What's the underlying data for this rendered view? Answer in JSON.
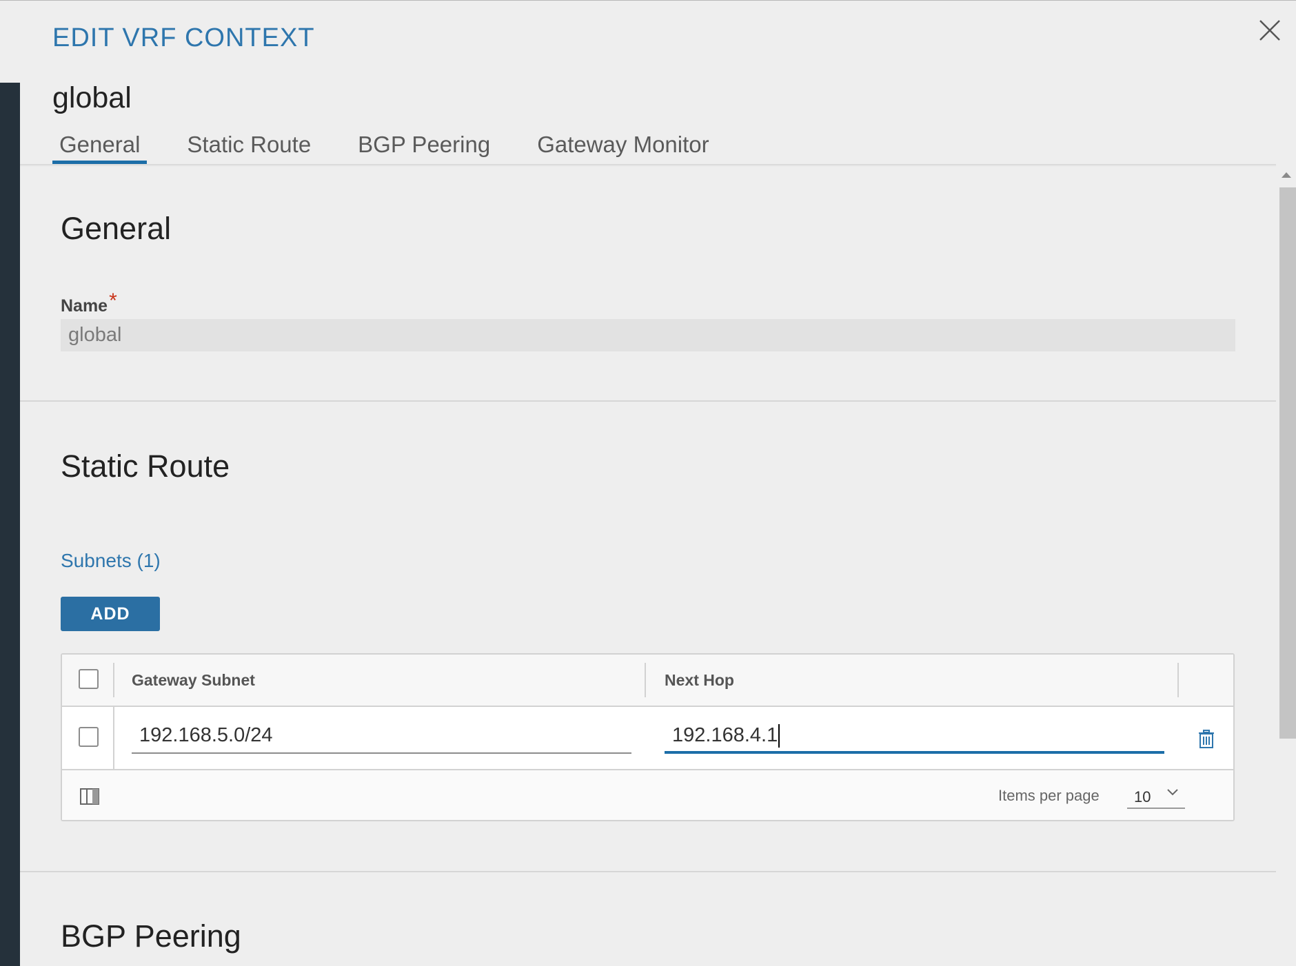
{
  "dialog": {
    "title": "EDIT VRF CONTEXT",
    "close_icon": "close-icon"
  },
  "header": {
    "name": "global"
  },
  "tabs": [
    {
      "label": "General",
      "active": true
    },
    {
      "label": "Static Route",
      "active": false
    },
    {
      "label": "BGP Peering",
      "active": false
    },
    {
      "label": "Gateway Monitor",
      "active": false
    }
  ],
  "general": {
    "title": "General",
    "name_label": "Name",
    "required_mark": "*",
    "name_value": "global"
  },
  "static_route": {
    "title": "Static Route",
    "subnets_label": "Subnets (1)",
    "add_label": "ADD",
    "columns": [
      "Gateway Subnet",
      "Next Hop"
    ],
    "rows": [
      {
        "gateway_subnet": "192.168.5.0/24",
        "next_hop": "192.168.4.1"
      }
    ],
    "footer": {
      "items_per_page_label": "Items per page",
      "items_per_page_value": "10"
    }
  },
  "bgp_peering": {
    "title": "BGP Peering"
  },
  "colors": {
    "accent": "#2e76ad",
    "button": "#2b6fa3",
    "required": "#c9341a",
    "left_rail": "#25313b"
  }
}
